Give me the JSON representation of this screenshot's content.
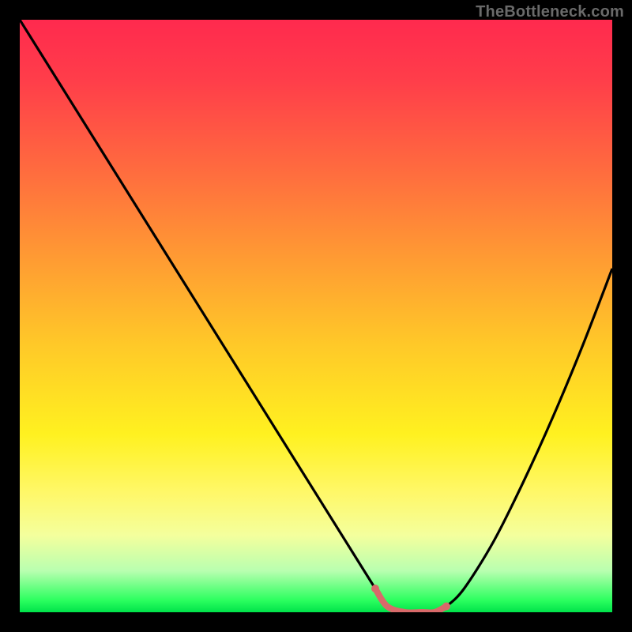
{
  "watermark": "TheBottleneck.com",
  "chart_data": {
    "type": "line",
    "title": "",
    "xlabel": "",
    "ylabel": "",
    "xlim": [
      0,
      100
    ],
    "ylim": [
      0,
      100
    ],
    "grid": false,
    "legend": false,
    "x": [
      0,
      5,
      10,
      15,
      20,
      25,
      30,
      35,
      40,
      45,
      50,
      55,
      60,
      62,
      65,
      68,
      70,
      72,
      75,
      80,
      85,
      90,
      95,
      100
    ],
    "values": [
      100,
      92,
      84,
      76,
      68,
      60,
      52,
      44,
      36,
      28,
      20,
      12,
      4,
      1,
      0,
      0,
      0,
      1,
      4,
      12,
      22,
      33,
      45,
      58
    ],
    "highlight_region": {
      "x_start": 60,
      "x_end": 72
    },
    "markers": [
      {
        "x": 60,
        "y": 4,
        "r": 5,
        "color": "#d86a6a"
      },
      {
        "x": 72,
        "y": 1,
        "r": 5,
        "color": "#d86a6a"
      }
    ],
    "highlight_stroke": {
      "color": "#d86a6a",
      "width": 8
    },
    "curve_stroke": {
      "color": "#000000",
      "width": 3.2
    },
    "background_gradient": [
      "#ff2a4e",
      "#ff3d4a",
      "#ff6a3f",
      "#ff9a33",
      "#ffc928",
      "#fff120",
      "#fff86a",
      "#f4ff9d",
      "#b9ffb0",
      "#2bff5f",
      "#00e24a"
    ]
  }
}
